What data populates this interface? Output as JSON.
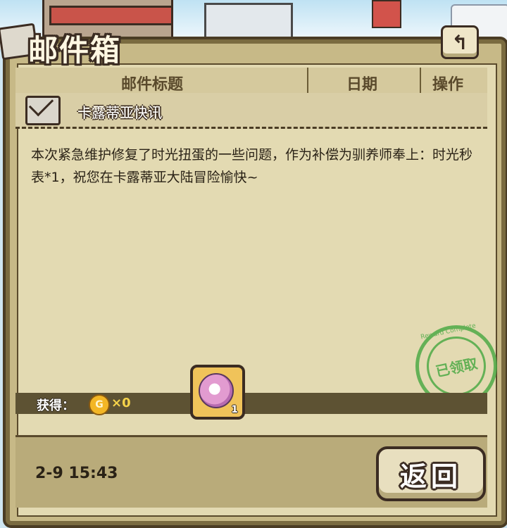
{
  "window": {
    "title": "邮件箱"
  },
  "table_header": {
    "col_title": "邮件标题",
    "col_date": "日期",
    "col_action": "操作"
  },
  "mail": {
    "subject": "卡露蒂亚快讯",
    "body": "本次紧急维护修复了时光扭蛋的一些问题，作为补偿为驯养师奉上：时光秒表*1，祝您在卡露蒂亚大陆冒险愉快~",
    "date": "2-9 15:43"
  },
  "rewards": {
    "label": "获得：",
    "coin_symbol": "G",
    "coin_count": "×0",
    "item": {
      "icon": "stopwatch-item-icon",
      "count": "1"
    }
  },
  "stamp": {
    "text": "已领取",
    "ring_text": "Reward Complete"
  },
  "buttons": {
    "back_arrow_icon": "back-arrow-icon",
    "return_label": "返回"
  },
  "colors": {
    "panel": "#c7b987",
    "paper": "#e3dab2",
    "stamp": "#4eaa46",
    "coin": "#f3b625"
  }
}
